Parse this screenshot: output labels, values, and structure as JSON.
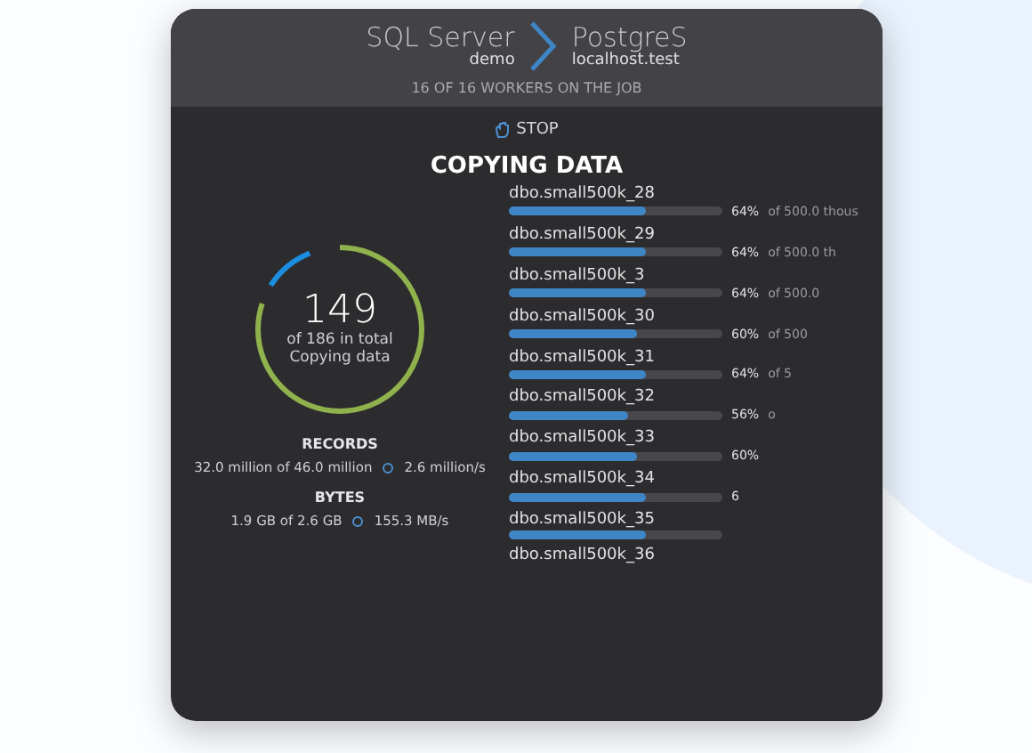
{
  "source": {
    "name": "SQL Server",
    "host": "demo"
  },
  "target": {
    "name": "PostgreS",
    "host": "localhost.test"
  },
  "workers": "16 OF 16 WORKERS ON THE JOB",
  "stop_button": "STOP",
  "heading": "COPYING DATA",
  "progress": {
    "count": "149",
    "total": "of 186 in total",
    "status": "Copying data"
  },
  "records": {
    "label": "RECORDS",
    "done": "32.0 million of 46.0 million",
    "rate": "2.6 million/s"
  },
  "bytes": {
    "label": "BYTES",
    "done": "1.9 GB of 2.6 GB",
    "rate": "155.3 MB/s"
  },
  "tables": [
    {
      "name": "dbo.small500k_28",
      "level": 0.64,
      "percent": "64%",
      "of": "of 500.0 thous"
    },
    {
      "name": "dbo.small500k_29",
      "level": 0.64,
      "percent": "64%",
      "of": "of 500.0 th"
    },
    {
      "name": "dbo.small500k_3",
      "level": 0.64,
      "percent": "64%",
      "of": "of 500.0"
    },
    {
      "name": "dbo.small500k_30",
      "level": 0.6,
      "percent": "60%",
      "of": "of 500"
    },
    {
      "name": "dbo.small500k_31",
      "level": 0.64,
      "percent": "64%",
      "of": "of 5"
    },
    {
      "name": "dbo.small500k_32",
      "level": 0.56,
      "percent": "56%",
      "of": "o"
    },
    {
      "name": "dbo.small500k_33",
      "level": 0.6,
      "percent": "60%"
    },
    {
      "name": "dbo.small500k_34",
      "level": 0.64,
      "percent": "6"
    },
    {
      "name": "dbo.small500k_35",
      "level": 0.64
    },
    {
      "name": "dbo.small500k_36"
    }
  ]
}
